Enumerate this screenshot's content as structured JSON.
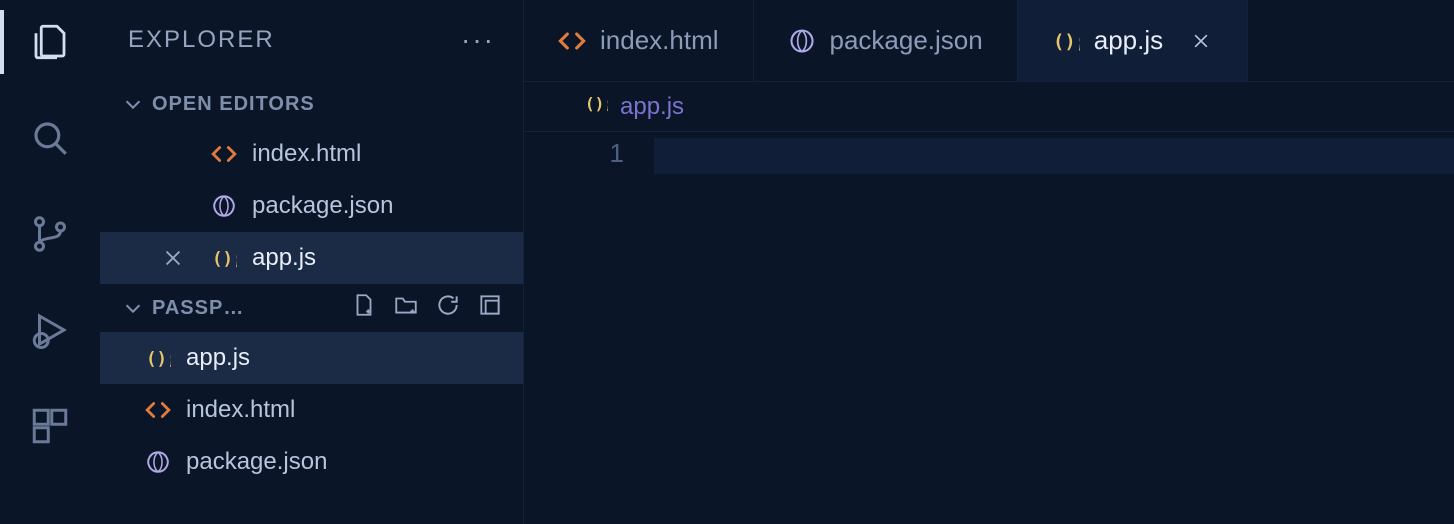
{
  "sidebar": {
    "title": "EXPLORER",
    "openEditorsLabel": "OPEN EDITORS",
    "folderName": "PASSP…",
    "openEditors": [
      {
        "label": "index.html"
      },
      {
        "label": "package.json"
      },
      {
        "label": "app.js"
      }
    ],
    "folderFiles": [
      {
        "label": "app.js"
      },
      {
        "label": "index.html"
      },
      {
        "label": "package.json"
      }
    ]
  },
  "tabs": [
    {
      "label": "index.html"
    },
    {
      "label": "package.json"
    },
    {
      "label": "app.js"
    }
  ],
  "breadcrumb": {
    "label": "app.js"
  },
  "editor": {
    "lineNumber": "1"
  }
}
